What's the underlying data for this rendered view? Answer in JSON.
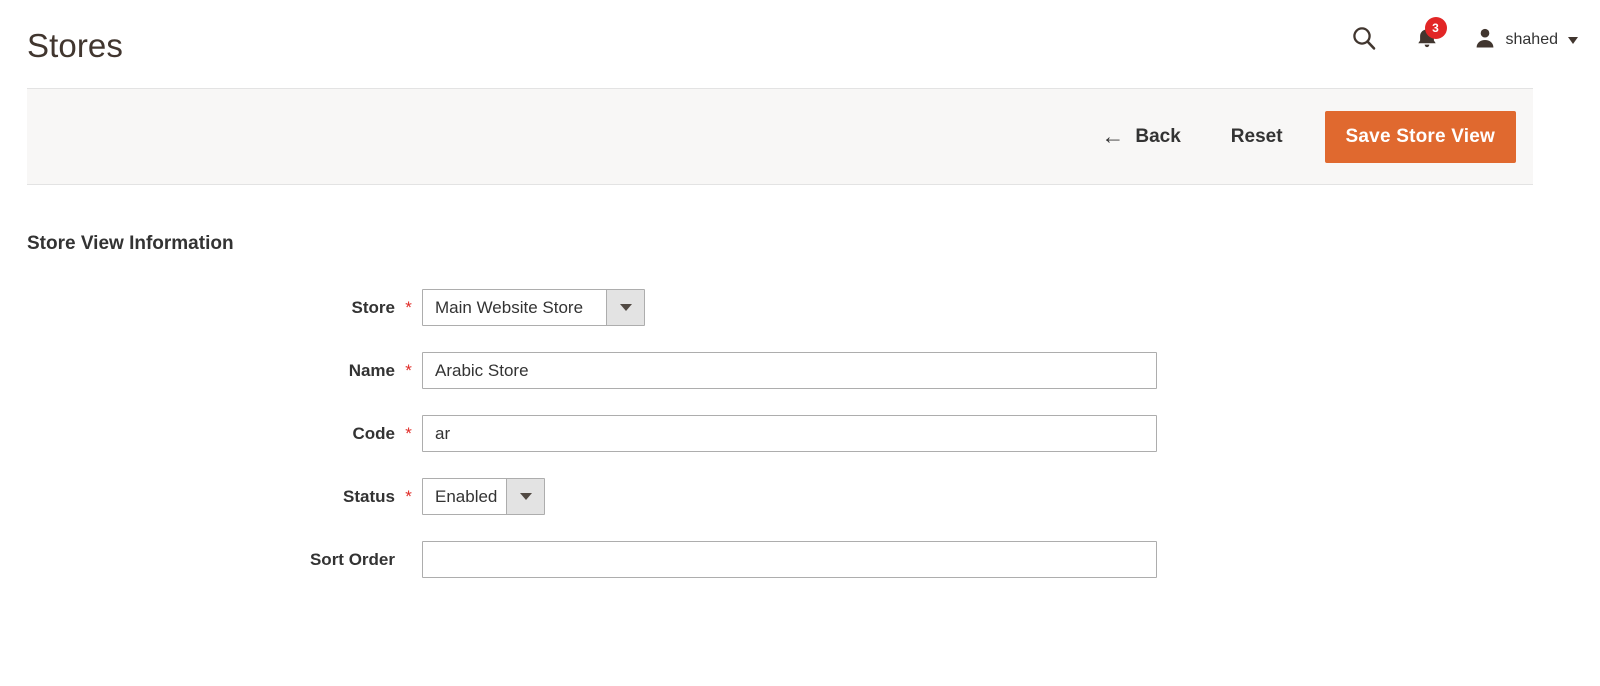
{
  "header": {
    "title": "Stores",
    "search_icon": "search-icon",
    "notifications": {
      "icon": "bell-icon",
      "count": "3"
    },
    "user": {
      "avatar_icon": "user-avatar-icon",
      "name": "shahed",
      "caret_icon": "chevron-down-icon"
    }
  },
  "toolbar": {
    "back_label": "Back",
    "back_icon": "arrow-left-icon",
    "reset_label": "Reset",
    "save_label": "Save Store View",
    "primary_color": "#e0692f"
  },
  "form": {
    "section_title": "Store View Information",
    "required_marker": "*",
    "fields": [
      {
        "label": "Store",
        "required": true,
        "type": "select",
        "value": "Main Website Store"
      },
      {
        "label": "Name",
        "required": true,
        "type": "text",
        "value": "Arabic Store",
        "placeholder": ""
      },
      {
        "label": "Code",
        "required": true,
        "type": "text",
        "value": "ar",
        "placeholder": ""
      },
      {
        "label": "Status",
        "required": true,
        "type": "select",
        "value": "Enabled"
      },
      {
        "label": "Sort Order",
        "required": false,
        "type": "text",
        "value": "",
        "placeholder": ""
      }
    ]
  }
}
